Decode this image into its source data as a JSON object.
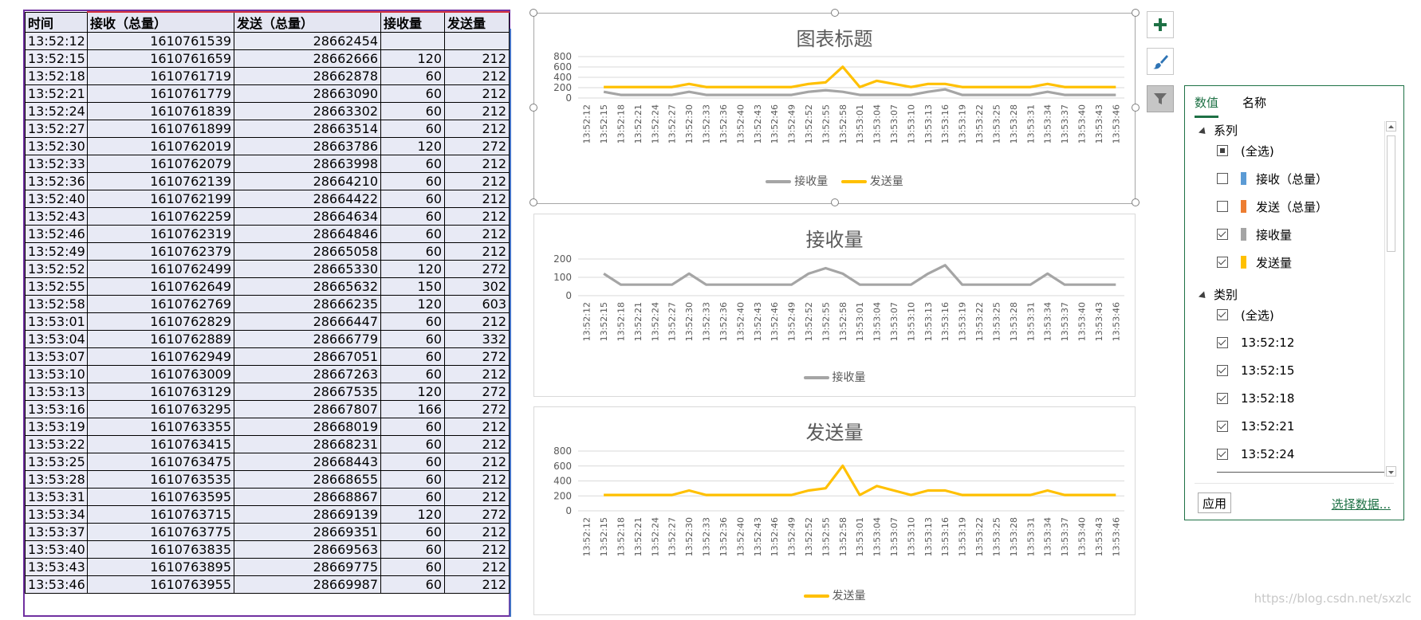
{
  "sheet": {
    "headers": [
      "时间",
      "接收（总量）",
      "发送（总量）",
      "接收量",
      "发送量"
    ],
    "rows": [
      [
        "13:52:12",
        "1610761539",
        "28662454",
        "",
        ""
      ],
      [
        "13:52:15",
        "1610761659",
        "28662666",
        "120",
        "212"
      ],
      [
        "13:52:18",
        "1610761719",
        "28662878",
        "60",
        "212"
      ],
      [
        "13:52:21",
        "1610761779",
        "28663090",
        "60",
        "212"
      ],
      [
        "13:52:24",
        "1610761839",
        "28663302",
        "60",
        "212"
      ],
      [
        "13:52:27",
        "1610761899",
        "28663514",
        "60",
        "212"
      ],
      [
        "13:52:30",
        "1610762019",
        "28663786",
        "120",
        "272"
      ],
      [
        "13:52:33",
        "1610762079",
        "28663998",
        "60",
        "212"
      ],
      [
        "13:52:36",
        "1610762139",
        "28664210",
        "60",
        "212"
      ],
      [
        "13:52:40",
        "1610762199",
        "28664422",
        "60",
        "212"
      ],
      [
        "13:52:43",
        "1610762259",
        "28664634",
        "60",
        "212"
      ],
      [
        "13:52:46",
        "1610762319",
        "28664846",
        "60",
        "212"
      ],
      [
        "13:52:49",
        "1610762379",
        "28665058",
        "60",
        "212"
      ],
      [
        "13:52:52",
        "1610762499",
        "28665330",
        "120",
        "272"
      ],
      [
        "13:52:55",
        "1610762649",
        "28665632",
        "150",
        "302"
      ],
      [
        "13:52:58",
        "1610762769",
        "28666235",
        "120",
        "603"
      ],
      [
        "13:53:01",
        "1610762829",
        "28666447",
        "60",
        "212"
      ],
      [
        "13:53:04",
        "1610762889",
        "28666779",
        "60",
        "332"
      ],
      [
        "13:53:07",
        "1610762949",
        "28667051",
        "60",
        "272"
      ],
      [
        "13:53:10",
        "1610763009",
        "28667263",
        "60",
        "212"
      ],
      [
        "13:53:13",
        "1610763129",
        "28667535",
        "120",
        "272"
      ],
      [
        "13:53:16",
        "1610763295",
        "28667807",
        "166",
        "272"
      ],
      [
        "13:53:19",
        "1610763355",
        "28668019",
        "60",
        "212"
      ],
      [
        "13:53:22",
        "1610763415",
        "28668231",
        "60",
        "212"
      ],
      [
        "13:53:25",
        "1610763475",
        "28668443",
        "60",
        "212"
      ],
      [
        "13:53:28",
        "1610763535",
        "28668655",
        "60",
        "212"
      ],
      [
        "13:53:31",
        "1610763595",
        "28668867",
        "60",
        "212"
      ],
      [
        "13:53:34",
        "1610763715",
        "28669139",
        "120",
        "272"
      ],
      [
        "13:53:37",
        "1610763775",
        "28669351",
        "60",
        "212"
      ],
      [
        "13:53:40",
        "1610763835",
        "28669563",
        "60",
        "212"
      ],
      [
        "13:53:43",
        "1610763895",
        "28669775",
        "60",
        "212"
      ],
      [
        "13:53:46",
        "1610763955",
        "28669987",
        "60",
        "212"
      ]
    ]
  },
  "charts": {
    "combined": {
      "title": "图表标题",
      "legend": [
        "接收量",
        "发送量"
      ]
    },
    "recv": {
      "title": "接收量",
      "legend": [
        "接收量"
      ]
    },
    "send": {
      "title": "发送量",
      "legend": [
        "发送量"
      ]
    }
  },
  "colors": {
    "recv": "#a5a5a5",
    "send": "#ffc000",
    "total_recv": "#5b9bd5",
    "total_send": "#ed7d31",
    "accent": "#1e7145"
  },
  "chart_data": [
    {
      "type": "line",
      "title": "图表标题",
      "categories": [
        "13:52:12",
        "13:52:15",
        "13:52:18",
        "13:52:21",
        "13:52:24",
        "13:52:27",
        "13:52:30",
        "13:52:33",
        "13:52:36",
        "13:52:40",
        "13:52:43",
        "13:52:46",
        "13:52:49",
        "13:52:52",
        "13:52:55",
        "13:52:58",
        "13:53:01",
        "13:53:04",
        "13:53:07",
        "13:53:10",
        "13:53:13",
        "13:53:16",
        "13:53:19",
        "13:53:22",
        "13:53:25",
        "13:53:28",
        "13:53:31",
        "13:53:34",
        "13:53:37",
        "13:53:40",
        "13:53:43",
        "13:53:46"
      ],
      "series": [
        {
          "name": "接收量",
          "values": [
            null,
            120,
            60,
            60,
            60,
            60,
            120,
            60,
            60,
            60,
            60,
            60,
            60,
            120,
            150,
            120,
            60,
            60,
            60,
            60,
            120,
            166,
            60,
            60,
            60,
            60,
            60,
            120,
            60,
            60,
            60,
            60
          ]
        },
        {
          "name": "发送量",
          "values": [
            null,
            212,
            212,
            212,
            212,
            212,
            272,
            212,
            212,
            212,
            212,
            212,
            212,
            272,
            302,
            603,
            212,
            332,
            272,
            212,
            272,
            272,
            212,
            212,
            212,
            212,
            212,
            272,
            212,
            212,
            212,
            212
          ]
        }
      ],
      "yticks": [
        0,
        200,
        400,
        600,
        800
      ],
      "ylim": [
        0,
        800
      ],
      "legend_position": "bottom"
    },
    {
      "type": "line",
      "title": "接收量",
      "categories": [
        "13:52:12",
        "13:52:15",
        "13:52:18",
        "13:52:21",
        "13:52:24",
        "13:52:27",
        "13:52:30",
        "13:52:33",
        "13:52:36",
        "13:52:40",
        "13:52:43",
        "13:52:46",
        "13:52:49",
        "13:52:52",
        "13:52:55",
        "13:52:58",
        "13:53:01",
        "13:53:04",
        "13:53:07",
        "13:53:10",
        "13:53:13",
        "13:53:16",
        "13:53:19",
        "13:53:22",
        "13:53:25",
        "13:53:28",
        "13:53:31",
        "13:53:34",
        "13:53:37",
        "13:53:40",
        "13:53:43",
        "13:53:46"
      ],
      "series": [
        {
          "name": "接收量",
          "values": [
            null,
            120,
            60,
            60,
            60,
            60,
            120,
            60,
            60,
            60,
            60,
            60,
            60,
            120,
            150,
            120,
            60,
            60,
            60,
            60,
            120,
            166,
            60,
            60,
            60,
            60,
            60,
            120,
            60,
            60,
            60,
            60
          ]
        }
      ],
      "yticks": [
        0,
        100,
        200
      ],
      "ylim": [
        0,
        200
      ],
      "legend_position": "bottom"
    },
    {
      "type": "line",
      "title": "发送量",
      "categories": [
        "13:52:12",
        "13:52:15",
        "13:52:18",
        "13:52:21",
        "13:52:24",
        "13:52:27",
        "13:52:30",
        "13:52:33",
        "13:52:36",
        "13:52:40",
        "13:52:43",
        "13:52:46",
        "13:52:49",
        "13:52:52",
        "13:52:55",
        "13:52:58",
        "13:53:01",
        "13:53:04",
        "13:53:07",
        "13:53:10",
        "13:53:13",
        "13:53:16",
        "13:53:19",
        "13:53:22",
        "13:53:25",
        "13:53:28",
        "13:53:31",
        "13:53:34",
        "13:53:37",
        "13:53:40",
        "13:53:43",
        "13:53:46"
      ],
      "series": [
        {
          "name": "发送量",
          "values": [
            null,
            212,
            212,
            212,
            212,
            212,
            272,
            212,
            212,
            212,
            212,
            212,
            212,
            272,
            302,
            603,
            212,
            332,
            272,
            212,
            272,
            272,
            212,
            212,
            212,
            212,
            212,
            272,
            212,
            212,
            212,
            212
          ]
        }
      ],
      "yticks": [
        0,
        200,
        400,
        600,
        800
      ],
      "ylim": [
        0,
        800
      ],
      "legend_position": "bottom"
    }
  ],
  "tools": {
    "add_icon": "plus-icon",
    "style_icon": "paintbrush-icon",
    "filter_icon": "funnel-icon"
  },
  "filter_panel": {
    "tabs": [
      "数值",
      "名称"
    ],
    "series_heading": "系列",
    "series": [
      {
        "label": "(全选)",
        "state": "partial"
      },
      {
        "label": "接收（总量）",
        "state": "unchecked",
        "color": "#5b9bd5"
      },
      {
        "label": "发送（总量）",
        "state": "unchecked",
        "color": "#ed7d31"
      },
      {
        "label": "接收量",
        "state": "checked",
        "color": "#a5a5a5"
      },
      {
        "label": "发送量",
        "state": "checked",
        "color": "#ffc000"
      }
    ],
    "category_heading": "类别",
    "categories": [
      {
        "label": "(全选)",
        "state": "checked"
      },
      {
        "label": "13:52:12",
        "state": "checked"
      },
      {
        "label": "13:52:15",
        "state": "checked"
      },
      {
        "label": "13:52:18",
        "state": "checked"
      },
      {
        "label": "13:52:21",
        "state": "checked"
      },
      {
        "label": "13:52:24",
        "state": "checked"
      }
    ],
    "apply_label": "应用",
    "select_data_label": "选择数据..."
  },
  "watermark": "https://blog.csdn.net/sxzlc"
}
